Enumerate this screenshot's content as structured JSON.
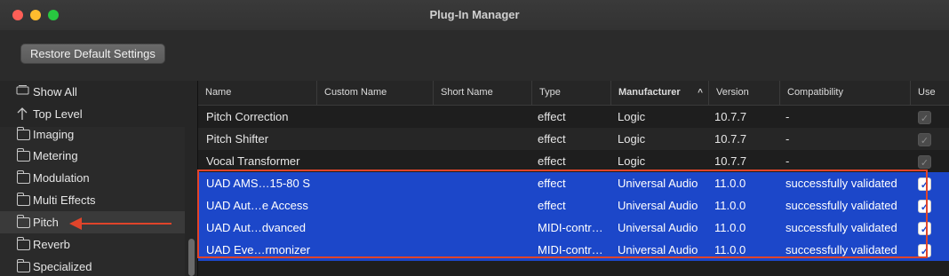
{
  "window": {
    "title": "Plug-In Manager"
  },
  "toolbar": {
    "restore_label": "Restore Default Settings"
  },
  "sidebar": {
    "items": [
      {
        "label": "Show All",
        "icon": "show-all-icon"
      },
      {
        "label": "Top Level",
        "icon": "up-arrow-icon"
      },
      {
        "label": "Imaging",
        "icon": "folder-icon"
      },
      {
        "label": "Metering",
        "icon": "folder-icon"
      },
      {
        "label": "Modulation",
        "icon": "folder-icon"
      },
      {
        "label": "Multi Effects",
        "icon": "folder-icon"
      },
      {
        "label": "Pitch",
        "icon": "folder-icon",
        "selected": true
      },
      {
        "label": "Reverb",
        "icon": "folder-icon"
      },
      {
        "label": "Specialized",
        "icon": "folder-icon"
      }
    ]
  },
  "table": {
    "columns": [
      "Name",
      "Custom Name",
      "Short Name",
      "Type",
      "Manufacturer",
      "Version",
      "Compatibility",
      "Use"
    ],
    "sort_indicator": "^",
    "rows": [
      {
        "name": "Pitch Correction",
        "custom": "",
        "short": "",
        "type": "effect",
        "manufacturer": "Logic",
        "version": "10.7.7",
        "compat": "-",
        "use": true,
        "use_enabled": false
      },
      {
        "name": "Pitch Shifter",
        "custom": "",
        "short": "",
        "type": "effect",
        "manufacturer": "Logic",
        "version": "10.7.7",
        "compat": "-",
        "use": true,
        "use_enabled": false
      },
      {
        "name": "Vocal Transformer",
        "custom": "",
        "short": "",
        "type": "effect",
        "manufacturer": "Logic",
        "version": "10.7.7",
        "compat": "-",
        "use": true,
        "use_enabled": false
      },
      {
        "name": "UAD AMS…15-80 S",
        "custom": "",
        "short": "",
        "type": "effect",
        "manufacturer": "Universal Audio",
        "version": "11.0.0",
        "compat": "successfully validated",
        "use": true,
        "use_enabled": true
      },
      {
        "name": "UAD Aut…e Access",
        "custom": "",
        "short": "",
        "type": "effect",
        "manufacturer": "Universal Audio",
        "version": "11.0.0",
        "compat": "successfully validated",
        "use": true,
        "use_enabled": true
      },
      {
        "name": "UAD Aut…dvanced",
        "custom": "",
        "short": "",
        "type": "MIDI-contr…",
        "manufacturer": "Universal Audio",
        "version": "11.0.0",
        "compat": "successfully validated",
        "use": true,
        "use_enabled": true
      },
      {
        "name": "UAD Eve…rmonizer",
        "custom": "",
        "short": "",
        "type": "MIDI-contr…",
        "manufacturer": "Universal Audio",
        "version": "11.0.0",
        "compat": "successfully validated",
        "use": true,
        "use_enabled": true
      }
    ]
  },
  "colors": {
    "highlight": "#1c47c9",
    "annotation": "#e0442a"
  }
}
